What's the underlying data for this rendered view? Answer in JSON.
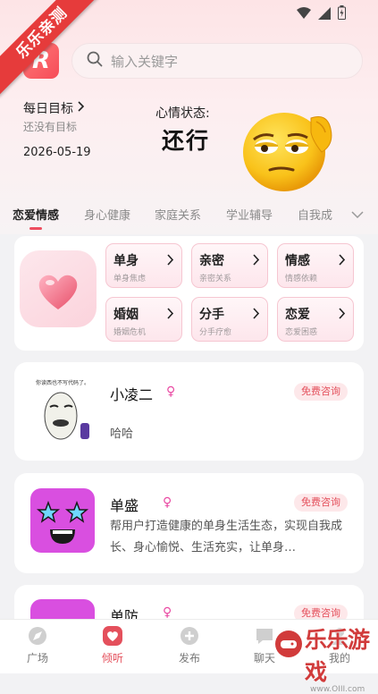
{
  "watermark": {
    "ribbon": "乐乐亲测",
    "text": "乐乐游戏",
    "url": "www.OIII.com"
  },
  "app": {
    "logo_letter": "R"
  },
  "search": {
    "placeholder": "输入关键字"
  },
  "daily_goal": {
    "title": "每日目标",
    "subtitle": "还没有目标",
    "date": "2026-05-19"
  },
  "mood": {
    "label": "心情状态:",
    "value": "还行"
  },
  "tabs": [
    {
      "label": "恋爱情感"
    },
    {
      "label": "身心健康"
    },
    {
      "label": "家庭关系"
    },
    {
      "label": "学业辅导"
    },
    {
      "label": "自我成"
    }
  ],
  "categories": [
    {
      "title": "单身",
      "sub": "单身焦虑"
    },
    {
      "title": "亲密",
      "sub": "亲密关系"
    },
    {
      "title": "情感",
      "sub": "情感依赖"
    },
    {
      "title": "婚姻",
      "sub": "婚姻危机"
    },
    {
      "title": "分手",
      "sub": "分手疗愈"
    },
    {
      "title": "恋爱",
      "sub": "恋爱困惑"
    }
  ],
  "consultants": [
    {
      "name": "小凌二",
      "gender": "♀",
      "badge": "免费咨询",
      "desc": "哈哈",
      "avatar_caption": "你读西也不写代码了。"
    },
    {
      "name": "单盛",
      "gender": "♀",
      "badge": "免费咨询",
      "desc": "帮用户打造健康的单身生活生态，实现自我成长、身心愉悦、生活充实，让单身…"
    },
    {
      "name": "单防",
      "gender": "♀",
      "badge": "免费咨询",
      "desc": ""
    }
  ],
  "bottom_nav": [
    {
      "label": "广场"
    },
    {
      "label": "倾听"
    },
    {
      "label": "发布"
    },
    {
      "label": "聊天"
    },
    {
      "label": "我的"
    }
  ],
  "colors": {
    "accent": "#e4505c",
    "tab_indicator": "#ee4d5f",
    "female": "#e94aa3"
  }
}
